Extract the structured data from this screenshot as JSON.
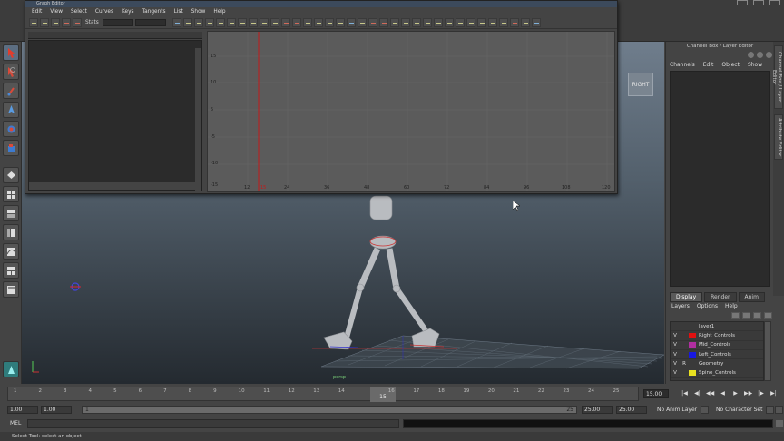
{
  "graph_editor": {
    "title": "Graph Editor",
    "menu": [
      "Edit",
      "View",
      "Select",
      "Curves",
      "Keys",
      "Tangents",
      "List",
      "Show",
      "Help"
    ],
    "stats_label": "Stats",
    "y_ticks": [
      "15",
      "10",
      "5",
      "-5",
      "-10",
      "-15"
    ],
    "x_ticks": [
      "12",
      "24",
      "36",
      "48",
      "60",
      "72",
      "84",
      "96",
      "108",
      "120"
    ],
    "current_frame_label": "15"
  },
  "viewport": {
    "view_cube_label": "RIGHT",
    "ground_label": "persp"
  },
  "channel_box": {
    "title": "Channel Box / Layer Editor",
    "menu": [
      "Channels",
      "Edit",
      "Object",
      "Show"
    ],
    "side_tabs": [
      "Channel Box / Layer Editor",
      "Attribute Editor"
    ]
  },
  "layer_editor": {
    "tabs": [
      "Display",
      "Render",
      "Anim"
    ],
    "active_tab": "Display",
    "menu": [
      "Layers",
      "Options",
      "Help"
    ],
    "layers": [
      {
        "visible": "",
        "ref": "",
        "name": "layer1",
        "color": "#3a3a3a"
      },
      {
        "visible": "V",
        "ref": "",
        "name": "Right_Controls",
        "color": "#e01010"
      },
      {
        "visible": "V",
        "ref": "",
        "name": "Mid_Controls",
        "color": "#b02ea0"
      },
      {
        "visible": "V",
        "ref": "",
        "name": "Left_Controls",
        "color": "#1818e0"
      },
      {
        "visible": "V",
        "ref": "R",
        "name": "Geometry",
        "color": "#3a3a3a"
      },
      {
        "visible": "V",
        "ref": "",
        "name": "Spine_Controls",
        "color": "#e8e020"
      }
    ]
  },
  "time_slider": {
    "ticks": [
      "1",
      "2",
      "3",
      "4",
      "5",
      "6",
      "7",
      "8",
      "9",
      "10",
      "11",
      "12",
      "13",
      "14",
      "15",
      "16",
      "17",
      "18",
      "19",
      "20",
      "21",
      "22",
      "23",
      "24",
      "25"
    ],
    "current_frame": "15",
    "end_field": "15.00",
    "playback_buttons": [
      "|◀",
      "◀|",
      "◀◀",
      "◀",
      "▶",
      "▶▶",
      "|▶",
      "▶|"
    ]
  },
  "range_slider": {
    "anim_start": "1.00",
    "playback_start": "1.00",
    "range_start": "1",
    "range_end": "25",
    "playback_end": "25.00",
    "anim_end": "25.00",
    "anim_layer": "No Anim Layer",
    "character_set": "No Character Set"
  },
  "command_line": {
    "label": "MEL"
  },
  "help_line": {
    "text": "Select Tool: select an object"
  }
}
